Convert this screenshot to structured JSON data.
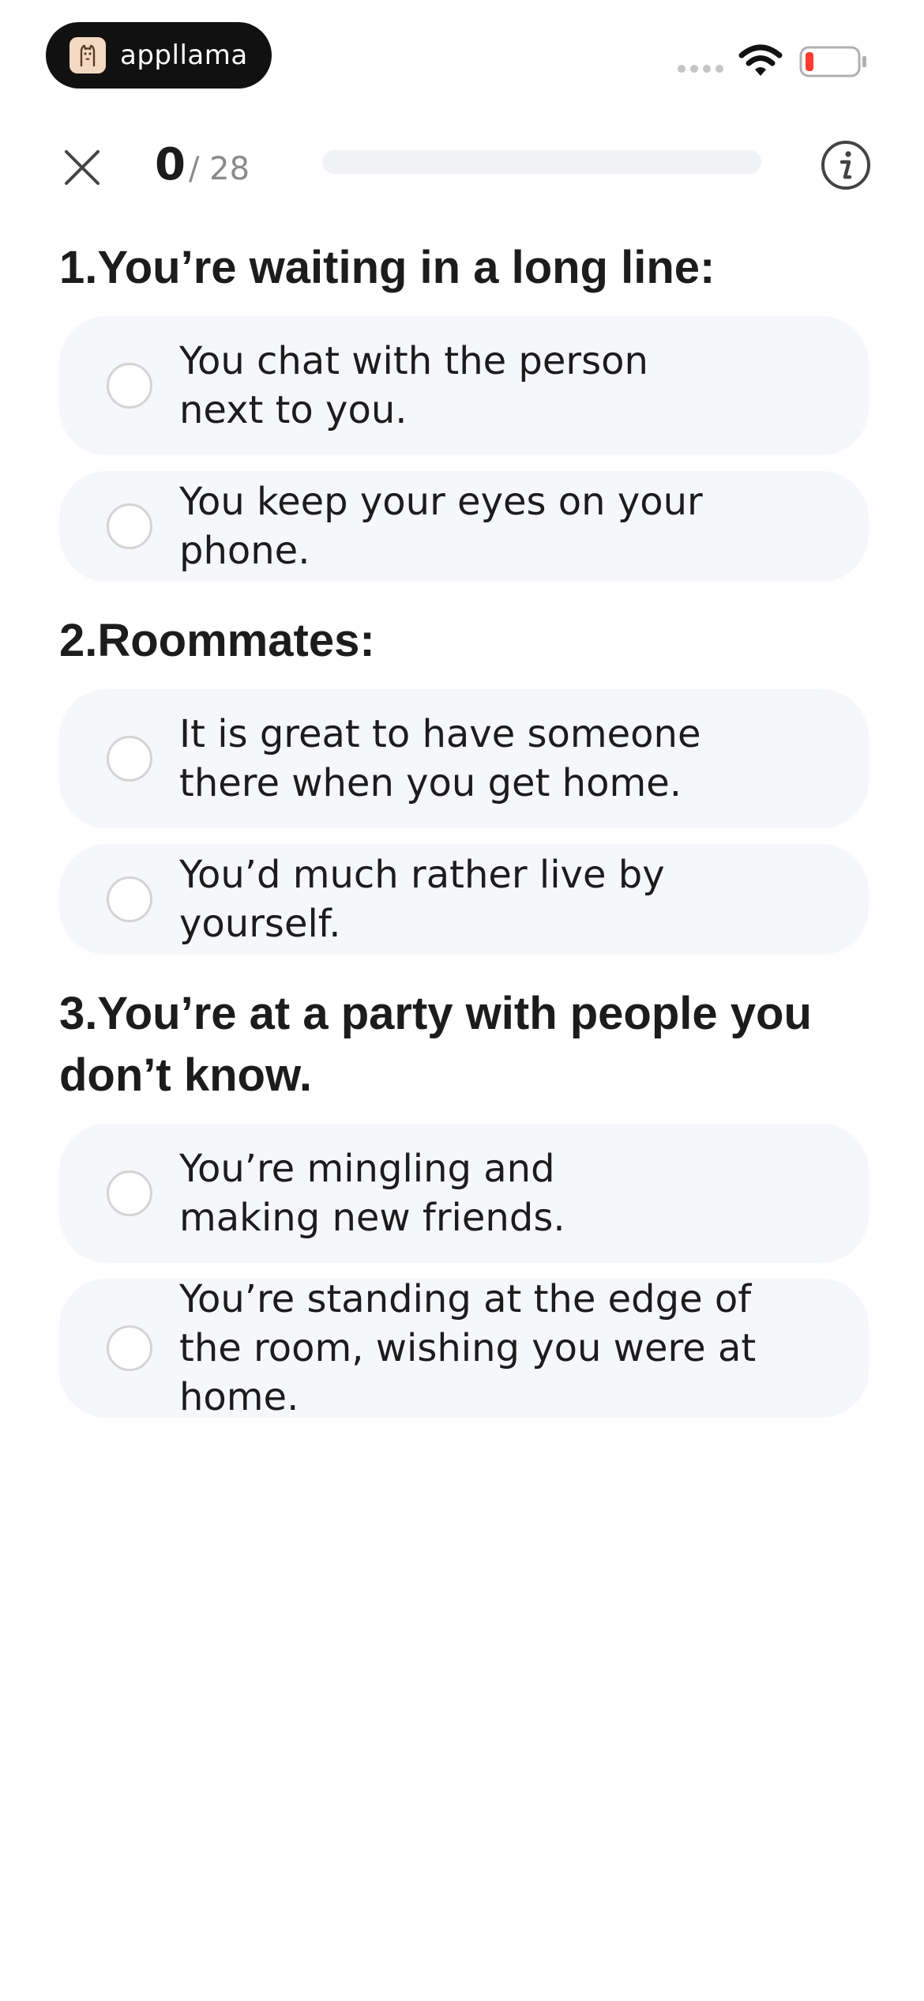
{
  "status_bar": {
    "app_name": "appllama",
    "app_logo_icon": "llama-icon",
    "signal_icon": "signal-dots-icon",
    "wifi_icon": "wifi-icon",
    "battery_icon": "battery-low-icon",
    "battery_color": "#ff3b30"
  },
  "top_bar": {
    "close_icon": "close-icon",
    "current": "0",
    "total": "/ 28",
    "progress": 0.0,
    "info_icon": "info-icon"
  },
  "questions": [
    {
      "title": "1.You’re waiting in a long line:",
      "options": [
        {
          "text": "You chat with the person next to you.",
          "selected": false
        },
        {
          "text": "You keep your eyes on your phone.",
          "selected": false
        }
      ]
    },
    {
      "title": "2.Roommates:",
      "options": [
        {
          "text": "It is great to have someone there when you get home.",
          "selected": false
        },
        {
          "text": "You’d much rather live by yourself.",
          "selected": false
        }
      ]
    },
    {
      "title": "3.You’re at a party with people you don’t know.",
      "options": [
        {
          "text": "You’re mingling and making new friends.",
          "selected": false
        },
        {
          "text": "You’re standing at the edge of the room, wishing you were at home.",
          "selected": false
        }
      ]
    }
  ],
  "colors": {
    "option_bg": "#f6f7fb",
    "text": "#1c1c1c",
    "progress_track": "#f1f2f6",
    "radio_border": "#d4d4d4"
  }
}
